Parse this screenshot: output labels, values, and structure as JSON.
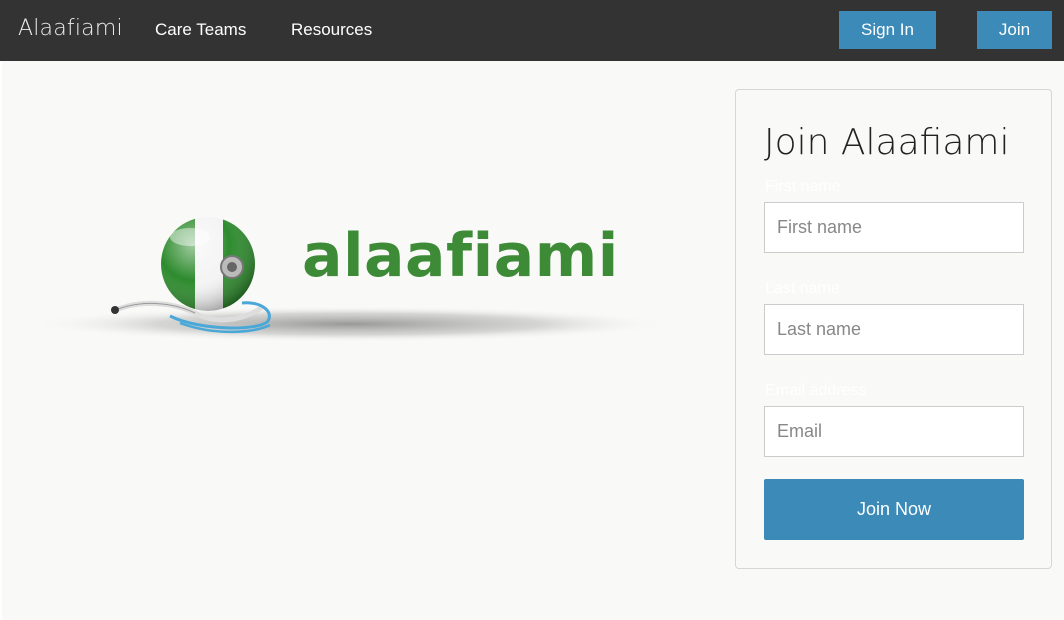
{
  "navbar": {
    "brand": "Alaafiami",
    "links": [
      "Care Teams",
      "Resources"
    ],
    "sign_in_label": "Sign In",
    "join_label": "Join"
  },
  "hero": {
    "logo_text": "alaafiami",
    "logo_icon": "globe-stethoscope-icon"
  },
  "signup": {
    "title": "Join Alaafiami",
    "first_name_label": "First name",
    "first_name_placeholder": "First name",
    "last_name_label": "Last name",
    "last_name_placeholder": "Last name",
    "email_label": "Email address",
    "email_placeholder": "Email",
    "submit_label": "Join Now"
  },
  "colors": {
    "navbar_bg": "#333333",
    "accent": "#3b8ab8",
    "logo_green": "#3d8b37",
    "page_bg": "#f9f9f7"
  }
}
